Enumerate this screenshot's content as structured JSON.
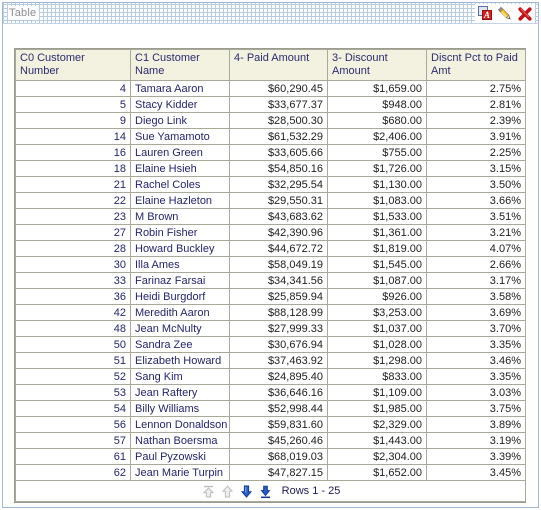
{
  "panel": {
    "title": "Table",
    "tools": [
      {
        "name": "format-a-icon",
        "title": "Format"
      },
      {
        "name": "edit-pencil-icon",
        "title": "Edit"
      },
      {
        "name": "delete-x-icon",
        "title": "Delete"
      }
    ]
  },
  "table": {
    "columns": [
      {
        "key": "customer_number",
        "label": "C0 Customer Number",
        "align": "right"
      },
      {
        "key": "customer_name",
        "label": "C1 Customer Name",
        "align": "left"
      },
      {
        "key": "paid_amount",
        "label": "4- Paid Amount",
        "align": "right"
      },
      {
        "key": "discount_amount",
        "label": "3- Discount Amount",
        "align": "right"
      },
      {
        "key": "discount_pct",
        "label": "Discnt Pct to Paid Amt",
        "align": "right"
      }
    ],
    "rows": [
      {
        "customer_number": "4",
        "customer_name": "Tamara Aaron",
        "paid_amount": "$60,290.45",
        "discount_amount": "$1,659.00",
        "discount_pct": "2.75%"
      },
      {
        "customer_number": "5",
        "customer_name": "Stacy Kidder",
        "paid_amount": "$33,677.37",
        "discount_amount": "$948.00",
        "discount_pct": "2.81%"
      },
      {
        "customer_number": "9",
        "customer_name": "Diego Link",
        "paid_amount": "$28,500.30",
        "discount_amount": "$680.00",
        "discount_pct": "2.39%"
      },
      {
        "customer_number": "14",
        "customer_name": "Sue Yamamoto",
        "paid_amount": "$61,532.29",
        "discount_amount": "$2,406.00",
        "discount_pct": "3.91%"
      },
      {
        "customer_number": "16",
        "customer_name": "Lauren Green",
        "paid_amount": "$33,605.66",
        "discount_amount": "$755.00",
        "discount_pct": "2.25%"
      },
      {
        "customer_number": "18",
        "customer_name": "Elaine Hsieh",
        "paid_amount": "$54,850.16",
        "discount_amount": "$1,726.00",
        "discount_pct": "3.15%"
      },
      {
        "customer_number": "21",
        "customer_name": "Rachel Coles",
        "paid_amount": "$32,295.54",
        "discount_amount": "$1,130.00",
        "discount_pct": "3.50%"
      },
      {
        "customer_number": "22",
        "customer_name": "Elaine Hazleton",
        "paid_amount": "$29,550.31",
        "discount_amount": "$1,083.00",
        "discount_pct": "3.66%"
      },
      {
        "customer_number": "23",
        "customer_name": "M Brown",
        "paid_amount": "$43,683.62",
        "discount_amount": "$1,533.00",
        "discount_pct": "3.51%"
      },
      {
        "customer_number": "27",
        "customer_name": "Robin Fisher",
        "paid_amount": "$42,390.96",
        "discount_amount": "$1,361.00",
        "discount_pct": "3.21%"
      },
      {
        "customer_number": "28",
        "customer_name": "Howard Buckley",
        "paid_amount": "$44,672.72",
        "discount_amount": "$1,819.00",
        "discount_pct": "4.07%"
      },
      {
        "customer_number": "30",
        "customer_name": "Illa Ames",
        "paid_amount": "$58,049.19",
        "discount_amount": "$1,545.00",
        "discount_pct": "2.66%"
      },
      {
        "customer_number": "33",
        "customer_name": "Farinaz Farsai",
        "paid_amount": "$34,341.56",
        "discount_amount": "$1,087.00",
        "discount_pct": "3.17%"
      },
      {
        "customer_number": "36",
        "customer_name": "Heidi Burgdorf",
        "paid_amount": "$25,859.94",
        "discount_amount": "$926.00",
        "discount_pct": "3.58%"
      },
      {
        "customer_number": "42",
        "customer_name": "Meredith Aaron",
        "paid_amount": "$88,128.99",
        "discount_amount": "$3,253.00",
        "discount_pct": "3.69%"
      },
      {
        "customer_number": "48",
        "customer_name": "Jean McNulty",
        "paid_amount": "$27,999.33",
        "discount_amount": "$1,037.00",
        "discount_pct": "3.70%"
      },
      {
        "customer_number": "50",
        "customer_name": "Sandra Zee",
        "paid_amount": "$30,676.94",
        "discount_amount": "$1,028.00",
        "discount_pct": "3.35%"
      },
      {
        "customer_number": "51",
        "customer_name": "Elizabeth Howard",
        "paid_amount": "$37,463.92",
        "discount_amount": "$1,298.00",
        "discount_pct": "3.46%"
      },
      {
        "customer_number": "52",
        "customer_name": "Sang Kim",
        "paid_amount": "$24,895.40",
        "discount_amount": "$833.00",
        "discount_pct": "3.35%"
      },
      {
        "customer_number": "53",
        "customer_name": "Jean Raftery",
        "paid_amount": "$36,646.16",
        "discount_amount": "$1,109.00",
        "discount_pct": "3.03%"
      },
      {
        "customer_number": "54",
        "customer_name": "Billy Williams",
        "paid_amount": "$52,998.44",
        "discount_amount": "$1,985.00",
        "discount_pct": "3.75%"
      },
      {
        "customer_number": "56",
        "customer_name": "Lennon Donaldson",
        "paid_amount": "$59,831.60",
        "discount_amount": "$2,329.00",
        "discount_pct": "3.89%"
      },
      {
        "customer_number": "57",
        "customer_name": "Nathan Boersma",
        "paid_amount": "$45,260.46",
        "discount_amount": "$1,443.00",
        "discount_pct": "3.19%"
      },
      {
        "customer_number": "61",
        "customer_name": "Paul Pyzowski",
        "paid_amount": "$68,019.03",
        "discount_amount": "$2,304.00",
        "discount_pct": "3.39%"
      },
      {
        "customer_number": "62",
        "customer_name": "Jean Marie Turpin",
        "paid_amount": "$47,827.15",
        "discount_amount": "$1,652.00",
        "discount_pct": "3.45%"
      }
    ]
  },
  "pager": {
    "first_icon": "first-page-icon",
    "prev_icon": "previous-page-icon",
    "next_icon": "next-page-icon",
    "last_icon": "last-page-icon",
    "range_text": "Rows 1 - 25",
    "enabled_color": "#2255cc",
    "disabled_color": "#c8c8c8"
  }
}
